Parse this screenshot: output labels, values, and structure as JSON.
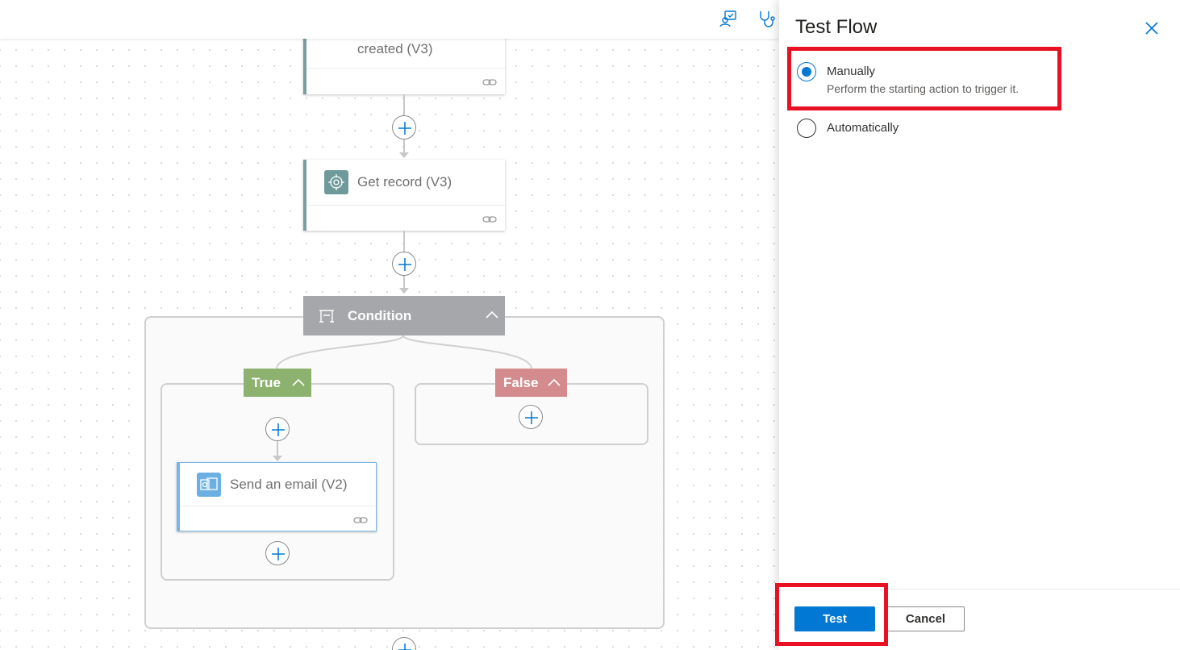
{
  "canvas": {
    "cards": [
      {
        "title": "created (V3)"
      },
      {
        "title": "Get record (V3)"
      },
      {
        "title": "Send an email (V2)"
      }
    ],
    "condition": {
      "title": "Condition",
      "true_label": "True",
      "false_label": "False"
    }
  },
  "panel": {
    "title": "Test Flow",
    "options": [
      {
        "label": "Manually",
        "description": "Perform the starting action to trigger it.",
        "selected": true
      },
      {
        "label": "Automatically",
        "selected": false
      }
    ],
    "test_button": "Test",
    "cancel_button": "Cancel"
  },
  "colors": {
    "accent": "#0078d4",
    "condition_header": "#a6a7aa",
    "true_branch": "#8db16e",
    "false_branch": "#d38b8d",
    "card_border": "#7a9e9f",
    "highlight": "#e81123"
  }
}
